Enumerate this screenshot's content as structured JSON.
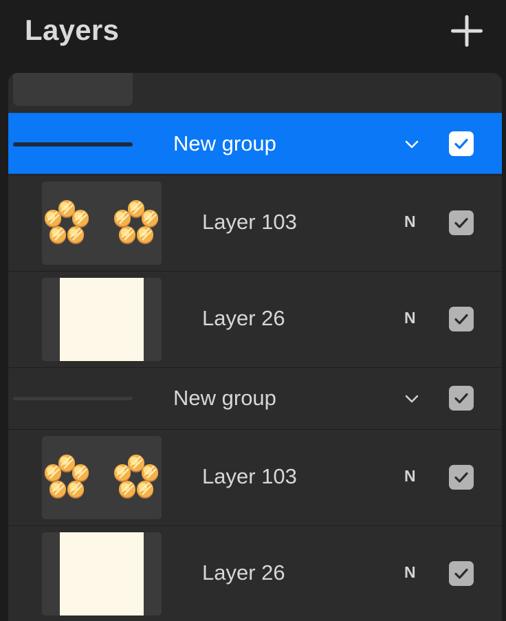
{
  "header": {
    "title": "Layers"
  },
  "rows": [
    {
      "kind": "group",
      "name": "New group",
      "selected": true,
      "visible": true
    },
    {
      "kind": "layer",
      "name": "Layer 103",
      "blend_mode": "N",
      "visible": true,
      "thumbnail": "flower-rings"
    },
    {
      "kind": "layer",
      "name": "Layer 26",
      "blend_mode": "N",
      "visible": true,
      "thumbnail": "cream-fill"
    },
    {
      "kind": "group",
      "name": "New group",
      "selected": false,
      "visible": true
    },
    {
      "kind": "layer",
      "name": "Layer 103",
      "blend_mode": "N",
      "visible": true,
      "thumbnail": "flower-rings"
    },
    {
      "kind": "layer",
      "name": "Layer 26",
      "blend_mode": "N",
      "visible": true,
      "thumbnail": "cream-fill"
    }
  ],
  "colors": {
    "selected_row": "#0a78f7",
    "panel_bg": "#2c2c2c",
    "background": "#1c1c1c",
    "checkbox_checked": "#b3b3b3",
    "canvas_fill": "#fef8e8"
  },
  "icons": {
    "add": "plus-icon",
    "expand": "chevron-down-icon",
    "visibility": "checkmark-icon"
  }
}
